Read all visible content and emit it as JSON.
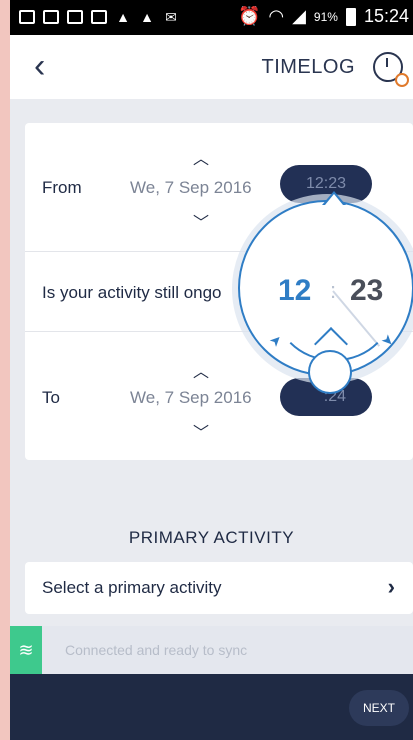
{
  "status_bar": {
    "battery_pct": "91%",
    "time": "15:24"
  },
  "header": {
    "title": "TIMELOG",
    "back_icon": "chevron-left-icon",
    "action_icon": "clock-icon"
  },
  "timelog": {
    "from": {
      "label": "From",
      "date": "We, 7 Sep 2016",
      "time": "12:23"
    },
    "ongoing": {
      "label": "Is your activity still ongo"
    },
    "to": {
      "label": "To",
      "date": "We, 7 Sep 2016",
      "time": ":24"
    }
  },
  "clock_picker": {
    "hour": "12",
    "minute": "23",
    "separator": ":"
  },
  "primary_activity": {
    "section_title": "PRIMARY ACTIVITY",
    "select_label": "Select a primary activity"
  },
  "sync": {
    "status_text": "Connected and ready to sync"
  },
  "footer": {
    "next_label": "NEXT"
  },
  "colors": {
    "navy": "#1f2a44",
    "accent_blue": "#2f7dc5",
    "sync_green": "#3ec98d"
  }
}
